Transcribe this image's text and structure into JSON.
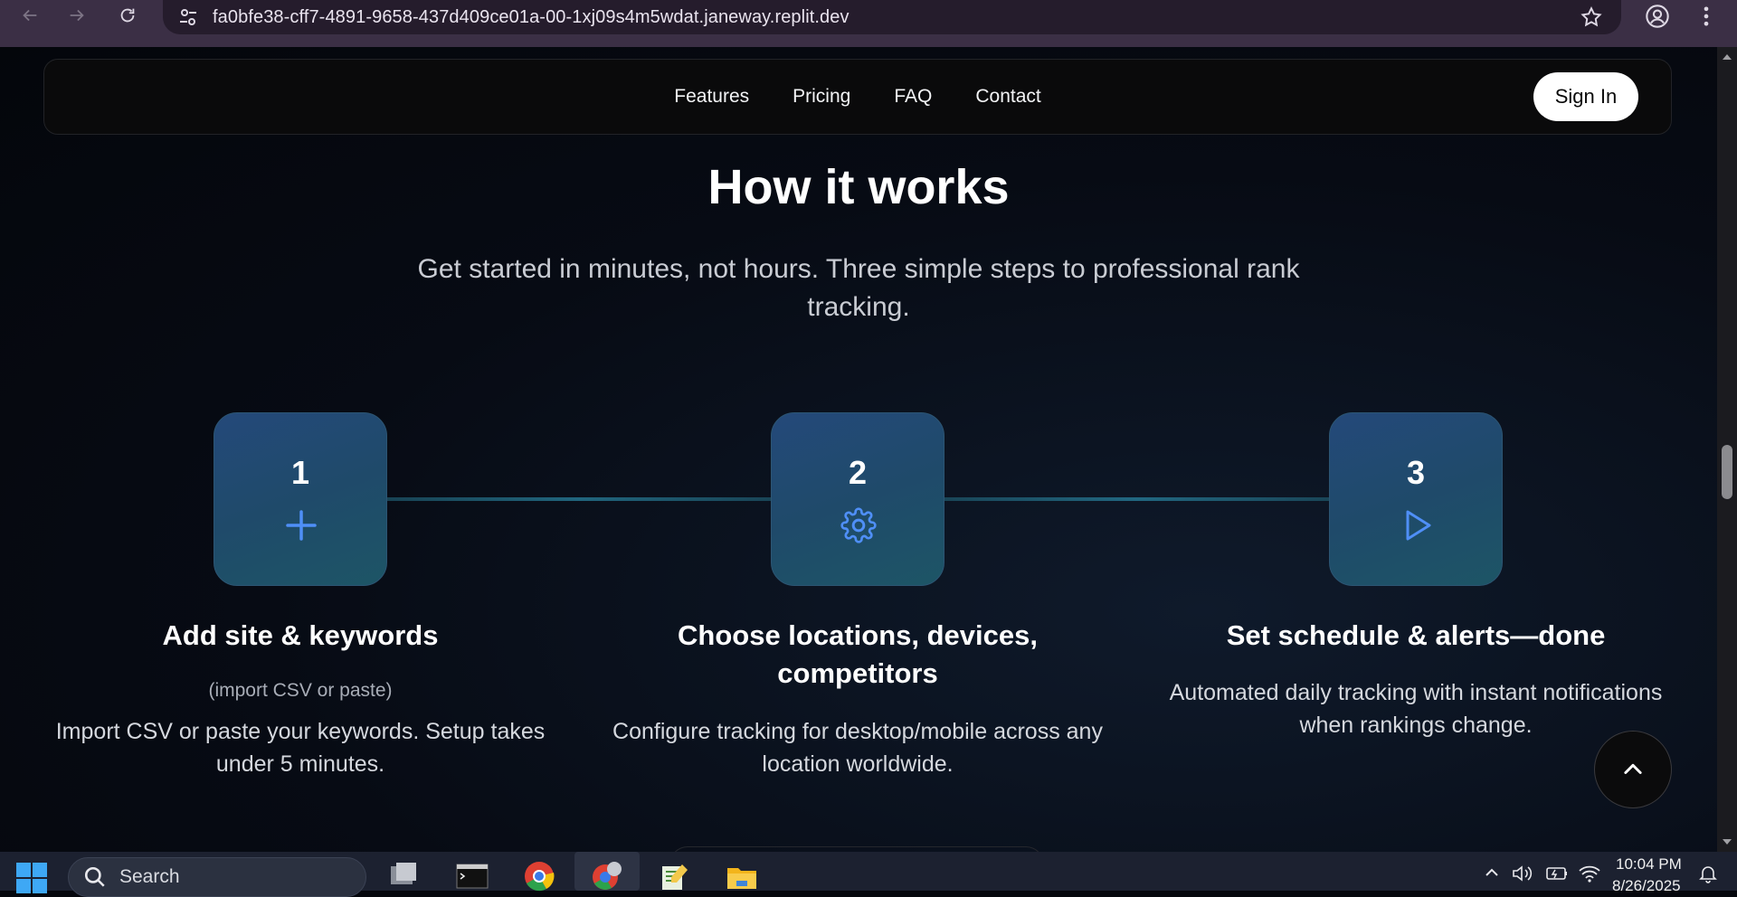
{
  "browser": {
    "url": "fa0bfe38-cff7-4891-9658-437d409ce01a-00-1xj09s4m5wdat.janeway.replit.dev"
  },
  "navbar": {
    "links": [
      "Features",
      "Pricing",
      "FAQ",
      "Contact"
    ],
    "signin_label": "Sign In"
  },
  "section": {
    "title": "How it works",
    "subtitle": "Get started in minutes, not hours. Three simple steps to professional rank tracking."
  },
  "steps": [
    {
      "number": "1",
      "icon": "plus-icon",
      "title": "Add site & keywords",
      "note": "(import CSV or paste)",
      "description": "Import CSV or paste your keywords. Setup takes under 5 minutes."
    },
    {
      "number": "2",
      "icon": "gear-icon",
      "title": "Choose locations, devices, competitors",
      "note": "",
      "description": "Configure tracking for desktop/mobile across any location worldwide."
    },
    {
      "number": "3",
      "icon": "play-icon",
      "title": "Set schedule & alerts—done",
      "note": "",
      "description": "Automated daily tracking with instant notifications when rankings change."
    }
  ],
  "taskbar": {
    "search_placeholder": "Search",
    "time": "10:04 PM",
    "date": "8/26/2025"
  },
  "colors": {
    "accent_icon": "#4f8ff7",
    "step_box": "#22497a",
    "connector": "#2a8aa8"
  }
}
